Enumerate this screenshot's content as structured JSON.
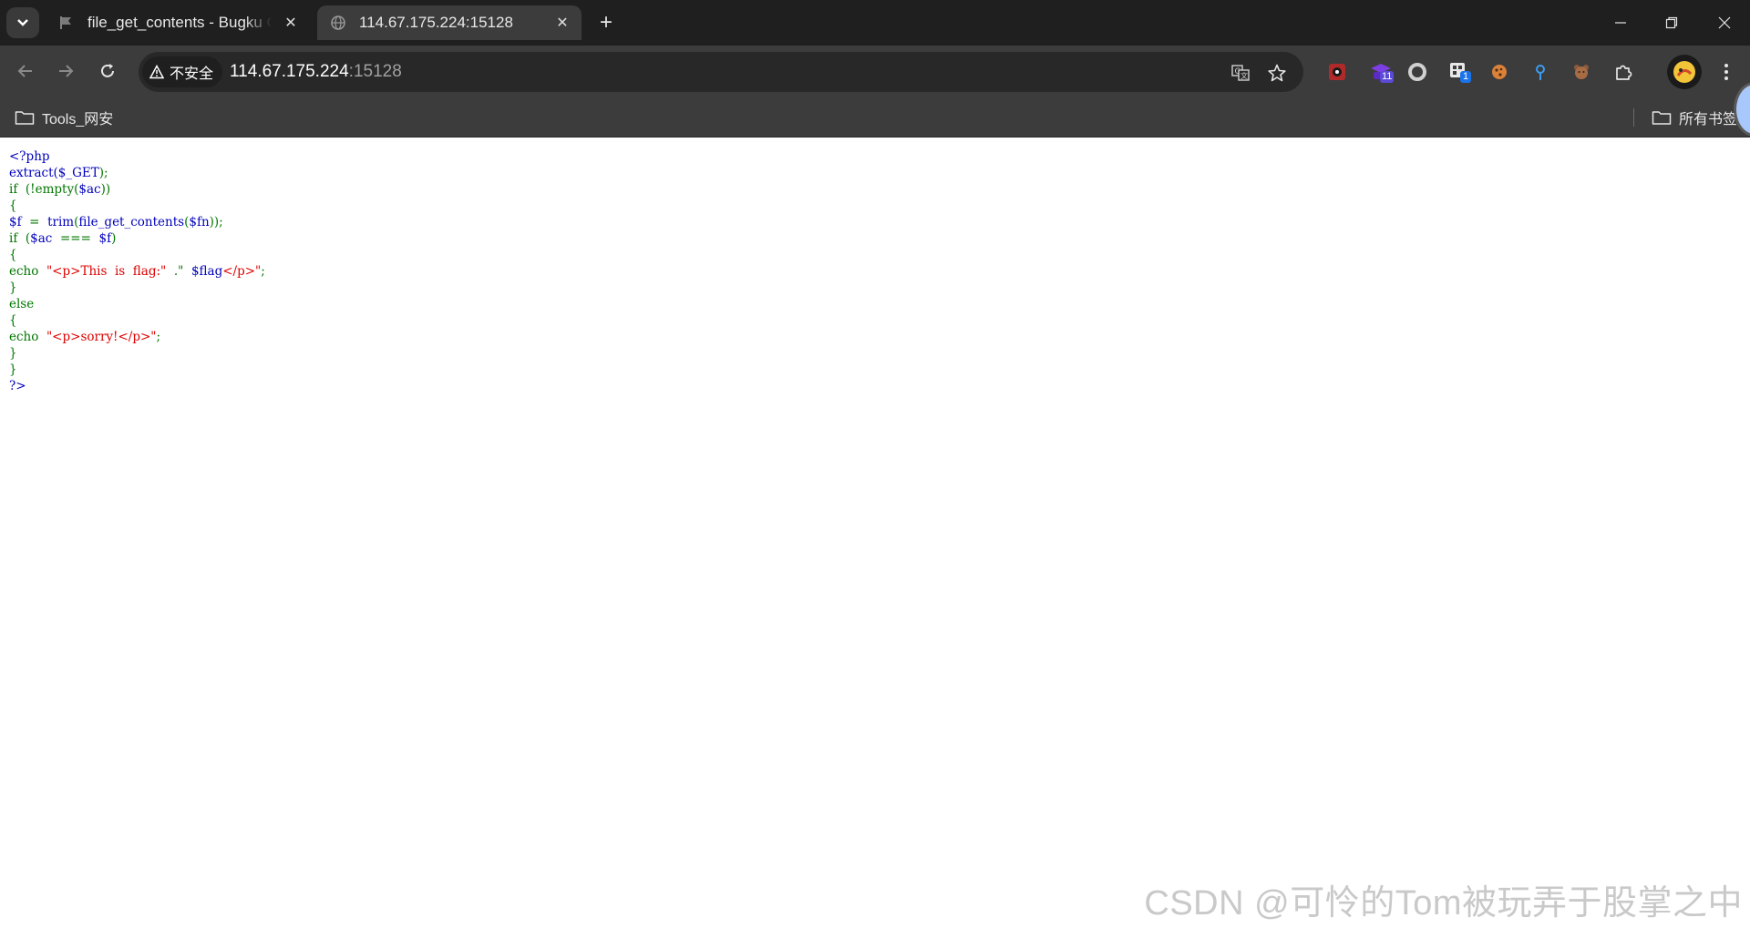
{
  "tabs": [
    {
      "title": "file_get_contents - Bugku CTF",
      "active": false,
      "icon": "flag-icon"
    },
    {
      "title": "114.67.175.224:15128",
      "active": true,
      "icon": "globe-icon"
    }
  ],
  "omnibox": {
    "security_label": "不安全",
    "url_host": "114.67.175.224",
    "url_port": ":15128"
  },
  "extensions": {
    "badge_1": "11",
    "badge_2": "1"
  },
  "bookmarks": {
    "folder_1": "Tools_网安",
    "all_bookmarks": "所有书签"
  },
  "code_lines": [
    [
      {
        "t": "<?php",
        "c": "blue"
      }
    ],
    [
      {
        "t": "extract(",
        "c": "blue"
      },
      {
        "t": "$_GET",
        "c": "blue"
      },
      {
        "t": ");",
        "c": "green"
      }
    ],
    [
      {
        "t": "if  (!",
        "c": "green"
      },
      {
        "t": "empty",
        "c": "green"
      },
      {
        "t": "(",
        "c": "green"
      },
      {
        "t": "$ac",
        "c": "blue"
      },
      {
        "t": "))",
        "c": "green"
      }
    ],
    [
      {
        "t": "{",
        "c": "green"
      }
    ],
    [
      {
        "t": "$f",
        "c": "blue"
      },
      {
        "t": "  =  ",
        "c": "green"
      },
      {
        "t": "trim",
        "c": "blue"
      },
      {
        "t": "(",
        "c": "green"
      },
      {
        "t": "file_get_contents",
        "c": "blue"
      },
      {
        "t": "(",
        "c": "green"
      },
      {
        "t": "$fn",
        "c": "blue"
      },
      {
        "t": "));",
        "c": "green"
      }
    ],
    [
      {
        "t": "if  (",
        "c": "green"
      },
      {
        "t": "$ac",
        "c": "blue"
      },
      {
        "t": "  ===  ",
        "c": "green"
      },
      {
        "t": "$f",
        "c": "blue"
      },
      {
        "t": ")",
        "c": "green"
      }
    ],
    [
      {
        "t": "{",
        "c": "green"
      }
    ],
    [
      {
        "t": "echo  ",
        "c": "green"
      },
      {
        "t": "\"<p>This  is  flag:\"",
        "c": "red"
      },
      {
        "t": "  .\"  ",
        "c": "green"
      },
      {
        "t": "$flag",
        "c": "blue"
      },
      {
        "t": "</p>\"",
        "c": "red"
      },
      {
        "t": ";",
        "c": "green"
      }
    ],
    [
      {
        "t": "}",
        "c": "green"
      }
    ],
    [
      {
        "t": "else",
        "c": "green"
      }
    ],
    [
      {
        "t": "{",
        "c": "green"
      }
    ],
    [
      {
        "t": "echo  ",
        "c": "green"
      },
      {
        "t": "\"<p>sorry!</p>\"",
        "c": "red"
      },
      {
        "t": ";",
        "c": "green"
      }
    ],
    [
      {
        "t": "}",
        "c": "green"
      }
    ],
    [
      {
        "t": "}",
        "c": "green"
      }
    ],
    [
      {
        "t": "?>",
        "c": "blue"
      }
    ]
  ],
  "watermark": "CSDN @可怜的Tom被玩弄于股掌之中",
  "colors": {
    "php_default": "#0000bb",
    "php_keyword": "#007700",
    "php_string": "#dd0000"
  }
}
